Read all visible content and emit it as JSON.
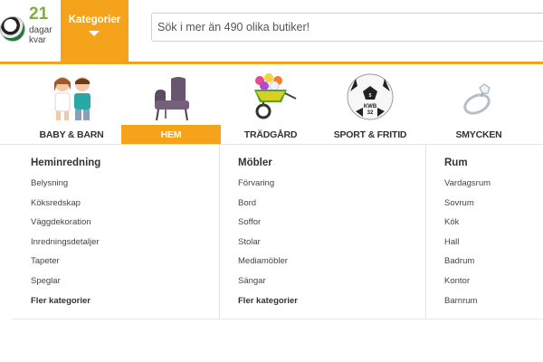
{
  "header": {
    "countdown_number": "21",
    "countdown_text": "dagar kvar",
    "kategorier_label": "Kategorier",
    "search_placeholder": "Sök i mer än 490 olika butiker!",
    "accent_color": "#f5a31a"
  },
  "categories": [
    {
      "label": "BABY & BARN",
      "icon": "children-icon",
      "active": false
    },
    {
      "label": "HEM",
      "icon": "armchair-icon",
      "active": true
    },
    {
      "label": "TRÄDGÅRD",
      "icon": "wheelbarrow-flowers-icon",
      "active": false
    },
    {
      "label": "SPORT & FRITID",
      "icon": "football-icon",
      "active": false
    },
    {
      "label": "SMYCKEN",
      "icon": "ring-icon",
      "active": false
    }
  ],
  "menu": {
    "columns": [
      {
        "title": "Heminredning",
        "items": [
          "Belysning",
          "Köksredskap",
          "Väggdekoration",
          "Inredningsdetaljer",
          "Tapeter",
          "Speglar",
          "Fler kategorier"
        ]
      },
      {
        "title": "Möbler",
        "items": [
          "Förvaring",
          "Bord",
          "Soffor",
          "Stolar",
          "Mediamöbler",
          "Sängar",
          "Fler kategorier"
        ]
      },
      {
        "title": "Rum",
        "items": [
          "Vardagsrum",
          "Sovrum",
          "Kök",
          "Hall",
          "Badrum",
          "Kontor",
          "Barnrum"
        ]
      }
    ]
  }
}
